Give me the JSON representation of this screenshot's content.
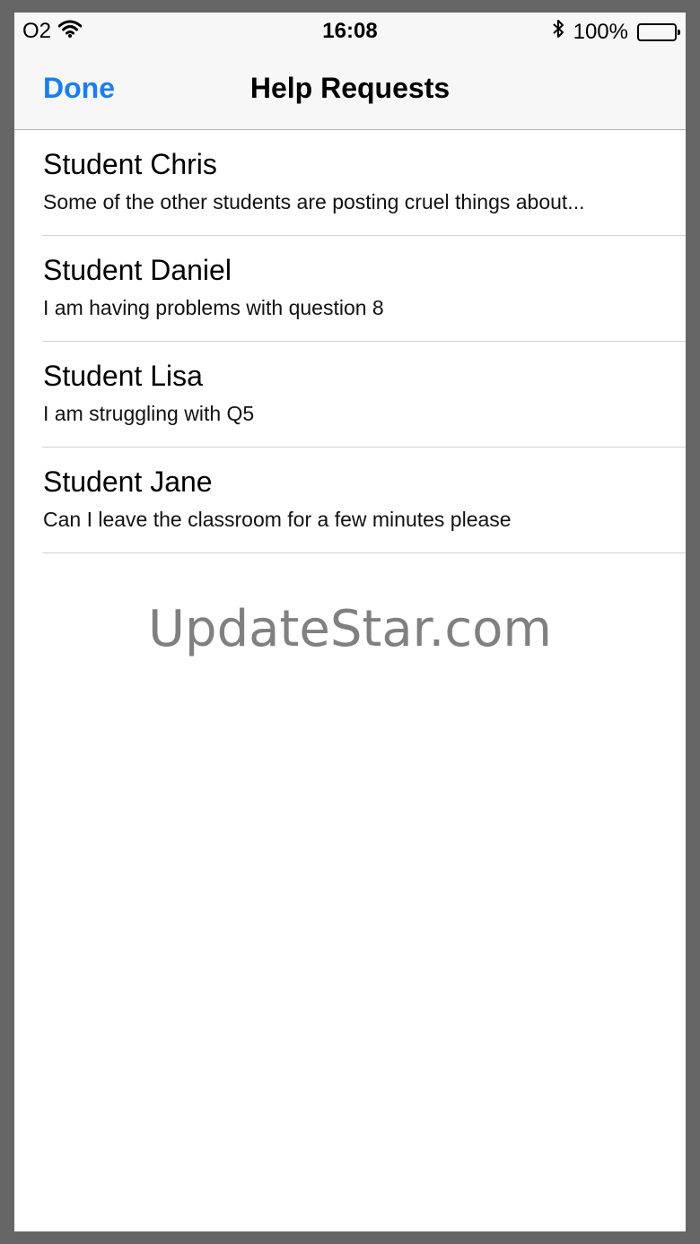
{
  "status_bar": {
    "carrier": "O2",
    "time": "16:08",
    "battery_percent": "100%",
    "battery_level": 1.0,
    "icons": [
      "wifi-icon",
      "bluetooth-icon",
      "battery-icon"
    ]
  },
  "nav": {
    "done_label": "Done",
    "title": "Help Requests"
  },
  "requests": [
    {
      "name": "Student Chris",
      "message": "Some of the other students are posting cruel things about..."
    },
    {
      "name": "Student Daniel",
      "message": "I am having problems with question 8"
    },
    {
      "name": "Student Lisa",
      "message": "I am struggling with Q5"
    },
    {
      "name": "Student Jane",
      "message": "Can I leave the classroom for a few minutes please"
    }
  ],
  "watermark": "UpdateStar.com",
  "colors": {
    "accent": "#1a7ef0",
    "bar_background": "#f7f7f7",
    "separator": "#d4d4d4"
  }
}
